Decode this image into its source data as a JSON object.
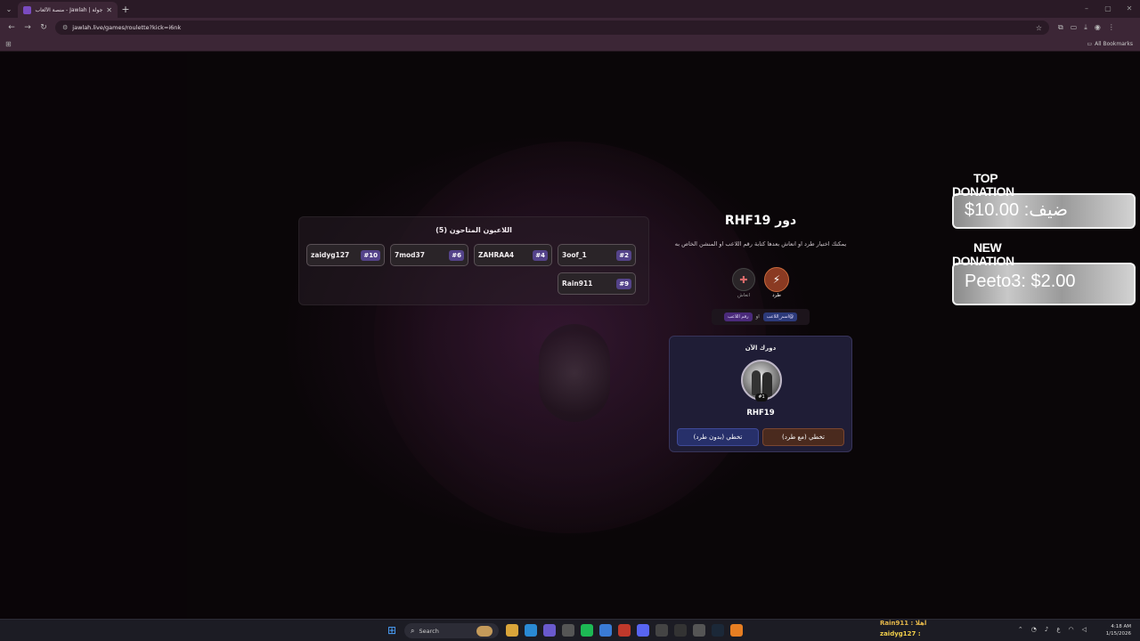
{
  "browser": {
    "tab_title": "جولة | Jawlah - منصة الألعاب ال...",
    "url": "jawlah.live/games/roulette?kick=i6nk",
    "all_bookmarks": "All Bookmarks"
  },
  "players": {
    "title": "اللاعبون المتاحون (5)",
    "list": [
      {
        "name": "3oof_1",
        "num": "#2"
      },
      {
        "name": "ZAHRAA4",
        "num": "#4"
      },
      {
        "name": "7mod37",
        "num": "#6"
      },
      {
        "name": "zaidyg127",
        "num": "#10"
      },
      {
        "name": "Rain911",
        "num": "#9"
      }
    ]
  },
  "turn": {
    "title": "دور RHF19",
    "description": "يمكنك اختيار طرد او انعاش بعدها كتابة رقم اللاعب او المنشن الخاص به",
    "kick_label": "طرد",
    "revive_label": "انعاش",
    "hint_mention": "@اسم_اللاعب",
    "hint_or": "او",
    "hint_number": "رقم اللاعب"
  },
  "current": {
    "label": "دورك الآن",
    "badge": "#1",
    "name": "RHF19",
    "skip_with_kick": "تخطي (مع طرد)",
    "skip_without_kick": "تخطي (بدون طرد)"
  },
  "donations": {
    "top_line1": "TOP",
    "top_line2": "DONATION",
    "top_value": "ضيف: 10.00$",
    "new_line1": "NEW",
    "new_line2": "DONATION",
    "new_value": "Peeto3: $2.00"
  },
  "taskbar": {
    "search": "Search",
    "chat1": "Rain911 : اهلا",
    "chat2": "zaidyg127 :",
    "time": "4:18 AM",
    "date": "1/15/2026"
  },
  "colors": {
    "kick": "#8a3a22",
    "number_badge": "#54438a",
    "skip_kick": "#4a2a1e",
    "skip_nokick": "#27306a"
  }
}
